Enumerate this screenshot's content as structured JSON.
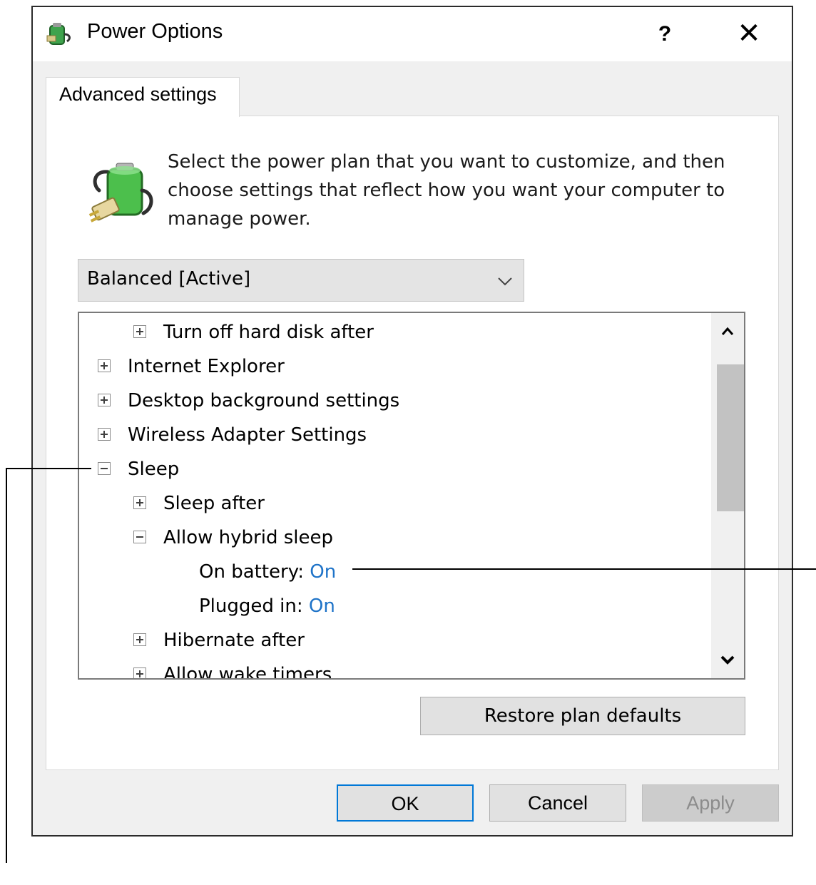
{
  "window": {
    "title": "Power Options",
    "help_label": "?",
    "close_label": "✕",
    "icon": "power-options-icon"
  },
  "tabs": [
    {
      "label": "Advanced settings",
      "selected": true
    }
  ],
  "description": "Select the power plan that you want to customize, and then choose settings that reflect how you want your computer to manage power.",
  "plan_select": {
    "value": "Balanced [Active]"
  },
  "tree": {
    "items": [
      {
        "label": "Turn off hard disk after",
        "expander": "plus"
      },
      {
        "label": "Internet Explorer",
        "expander": "plus"
      },
      {
        "label": "Desktop background settings",
        "expander": "plus"
      },
      {
        "label": "Wireless Adapter Settings",
        "expander": "plus"
      },
      {
        "label": "Sleep",
        "expander": "minus"
      },
      {
        "label": "Sleep after",
        "expander": "plus"
      },
      {
        "label": "Allow hybrid sleep",
        "expander": "minus"
      },
      {
        "label": "On battery:",
        "value": "On"
      },
      {
        "label": "Plugged in:",
        "value": "On"
      },
      {
        "label": "Hibernate after",
        "expander": "plus"
      },
      {
        "label": "Allow wake timers",
        "expander": "plus"
      }
    ]
  },
  "buttons": {
    "restore": "Restore plan defaults",
    "ok": "OK",
    "cancel": "Cancel",
    "apply": "Apply"
  },
  "colors": {
    "link_value": "#1e73c8",
    "focus_border": "#0078d7"
  }
}
